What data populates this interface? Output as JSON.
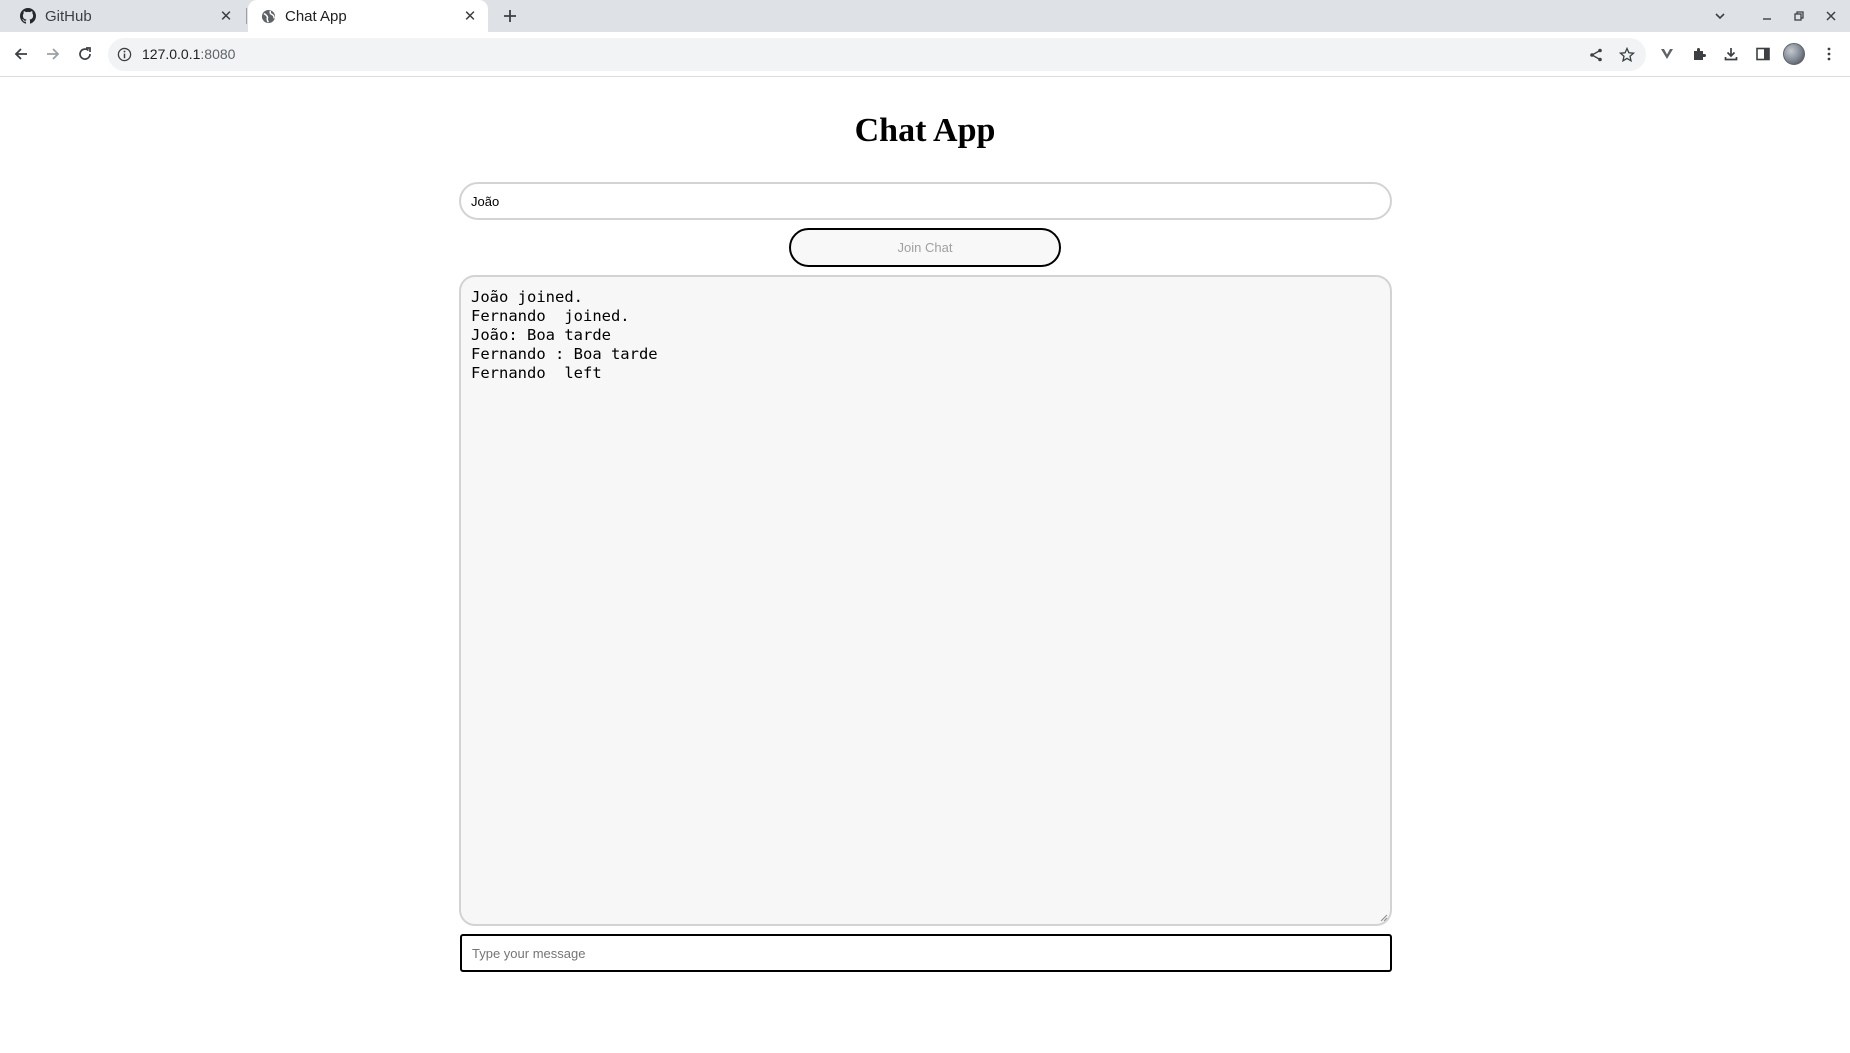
{
  "browser": {
    "tabs": [
      {
        "title": "GitHub",
        "icon": "github-icon",
        "active": false
      },
      {
        "title": "Chat App",
        "icon": "globe-icon",
        "active": true
      }
    ],
    "url_host": "127.0.0.1",
    "url_port": ":8080"
  },
  "page": {
    "title": "Chat App",
    "name_input_value": "João",
    "join_button_label": "Join Chat",
    "messages": [
      "João joined.",
      "Fernando  joined.",
      "João: Boa tarde",
      "Fernando : Boa tarde",
      "Fernando  left"
    ],
    "message_placeholder": "Type your message"
  }
}
